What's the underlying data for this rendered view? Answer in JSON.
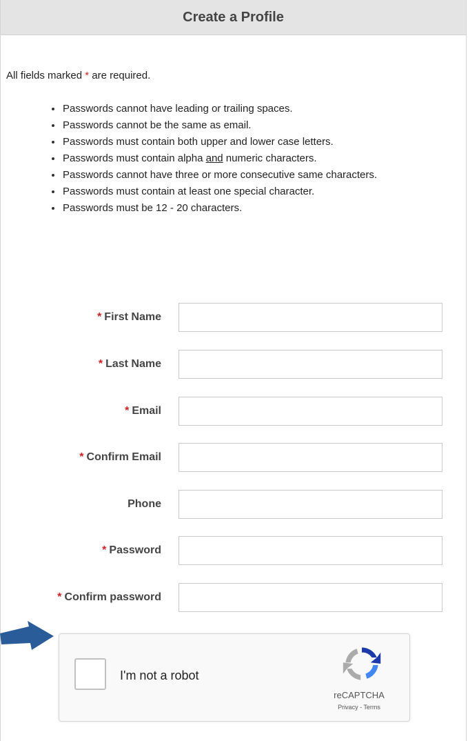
{
  "header": {
    "title": "Create a Profile"
  },
  "required_note": {
    "prefix": "All fields marked ",
    "star": "*",
    "suffix": " are required."
  },
  "password_rules": [
    "Passwords cannot have leading or trailing spaces.",
    "Passwords cannot be the same as email.",
    "Passwords must contain both upper and lower case letters.",
    {
      "before": "Passwords must contain alpha ",
      "underlined": "and",
      "after": " numeric characters."
    },
    "Passwords cannot have three or more consecutive same characters.",
    "Passwords must contain at least one special character.",
    "Passwords must be 12 - 20 characters."
  ],
  "form": {
    "fields": [
      {
        "label": "First Name",
        "required": true,
        "value": ""
      },
      {
        "label": "Last Name",
        "required": true,
        "value": ""
      },
      {
        "label": "Email",
        "required": true,
        "value": ""
      },
      {
        "label": "Confirm Email",
        "required": true,
        "value": ""
      },
      {
        "label": "Phone",
        "required": false,
        "value": ""
      },
      {
        "label": "Password",
        "required": true,
        "value": ""
      },
      {
        "label": "Confirm password",
        "required": true,
        "value": ""
      }
    ],
    "required_marker": "*"
  },
  "captcha": {
    "label": "I'm not a robot",
    "brand": "reCAPTCHA",
    "privacy": "Privacy",
    "separator": " - ",
    "terms": "Terms",
    "checked": false
  },
  "colors": {
    "required_star": "#d21f1f",
    "header_bg": "#e4e4e4",
    "arrow": "#2b5c9a"
  },
  "icons": {
    "arrow": "arrow-right-icon",
    "captcha_logo": "recaptcha-logo-icon"
  }
}
